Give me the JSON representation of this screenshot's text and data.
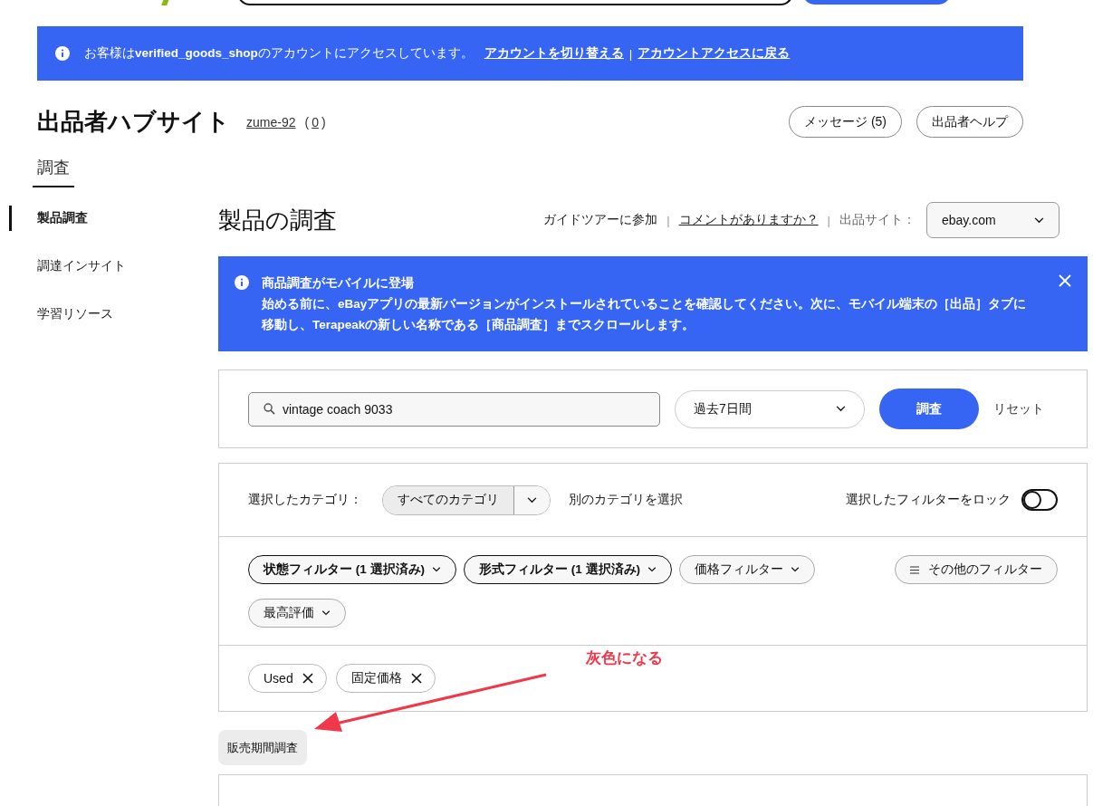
{
  "account_banner": {
    "text": "お客様は**verified_goods_shop**のアカウントにアクセスしています。",
    "links": [
      "アカウントを切り替える",
      "アカウントアクセスに戻る"
    ],
    "separator": "|"
  },
  "header": {
    "title": "出品者ハブサイト",
    "user": "zume-92",
    "score_open": "(",
    "score": "0",
    "score_close": ")",
    "buttons": [
      "メッセージ (5)",
      "出品者ヘルプ"
    ]
  },
  "tabs": [
    {
      "label": "調査",
      "selected": true
    }
  ],
  "sidebar": {
    "items": [
      {
        "label": "製品調査",
        "selected": true
      },
      {
        "label": "調達インサイト",
        "selected": false
      },
      {
        "label": "学習リソース",
        "selected": false
      }
    ]
  },
  "main": {
    "title": "製品の調査",
    "links": [
      {
        "kind": "plain",
        "label": "ガイドツアーに参加"
      },
      {
        "kind": "link",
        "label": "コメントがありますか？"
      }
    ],
    "separators": [
      "|",
      "|"
    ],
    "site_label": "出品サイト：",
    "site": "ebay.com"
  },
  "notice": {
    "title": "商品調査がモバイルに登場",
    "body": "始める前に、eBayアプリの最新バージョンがインストールされていることを確認してください。次に、モバイル端末の［出品］タブに移動し、Terapeakの新しい名称である［商品調査］までスクロールします。"
  },
  "search": {
    "value": "vintage coach 9033",
    "period": "過去7日間",
    "submit": "調査",
    "reset": "リセット"
  },
  "filters": {
    "category_label": "選択したカテゴリ：",
    "category": "すべてのカテゴリ",
    "other_category": "別のカテゴリを選択",
    "lock_label": "選択したフィルターをロック",
    "lock_on": false,
    "chips": [
      {
        "label": "状態フィルター (1 選択済み)",
        "active": true
      },
      {
        "label": "形式フィルター (1 選択済み)",
        "active": true
      },
      {
        "label": "価格フィルター",
        "active": false
      },
      {
        "label": "最高評価",
        "active": false
      }
    ],
    "more": "その他のフィルター",
    "tags": [
      "Used",
      "固定価格"
    ]
  },
  "sell_through_button": "販売期間調査",
  "annotation": {
    "text": "灰色になる"
  }
}
